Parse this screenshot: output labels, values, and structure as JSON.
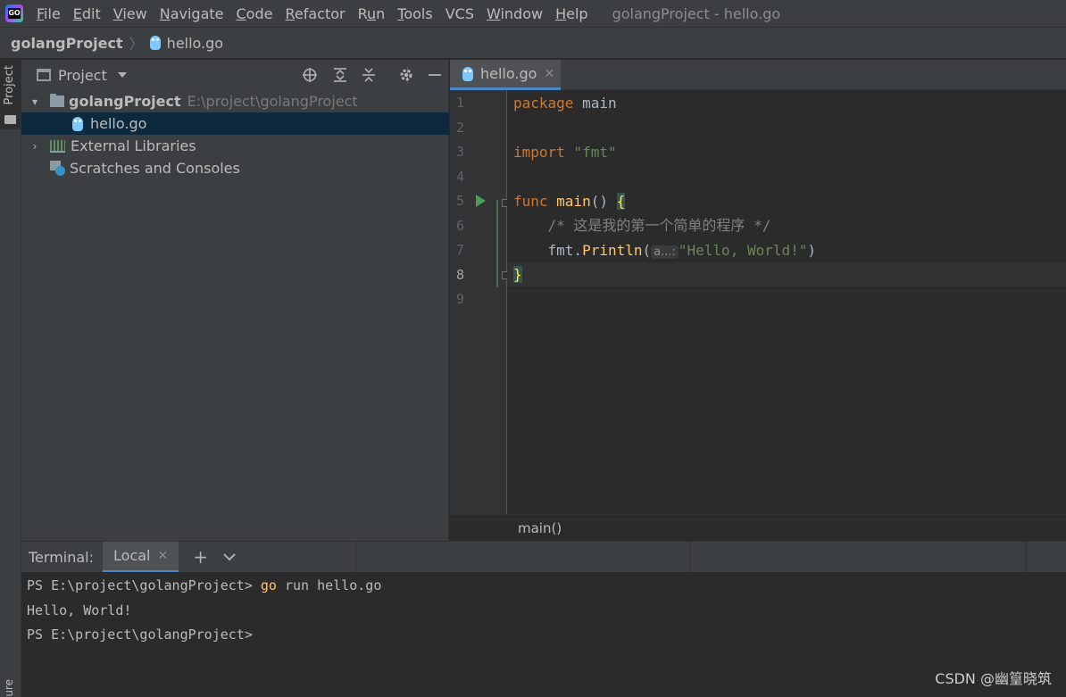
{
  "menubar": {
    "items": [
      {
        "label": "File",
        "mnemonic": "F",
        "rest": "ile"
      },
      {
        "label": "Edit",
        "mnemonic": "E",
        "rest": "dit"
      },
      {
        "label": "View",
        "mnemonic": "V",
        "rest": "iew"
      },
      {
        "label": "Navigate",
        "mnemonic": "N",
        "rest": "avigate"
      },
      {
        "label": "Code",
        "mnemonic": "C",
        "rest": "ode"
      },
      {
        "label": "Refactor",
        "mnemonic": "R",
        "rest": "efactor"
      },
      {
        "label": "Run",
        "mnemonic": "R",
        "rest": "un",
        "prefix": "R",
        "under": "u",
        "suffix": "n"
      },
      {
        "label": "Tools",
        "mnemonic": "T",
        "rest": "ools"
      },
      {
        "label": "VCS",
        "mnemonic": "",
        "rest": "VCS"
      },
      {
        "label": "Window",
        "mnemonic": "W",
        "rest": "indow"
      },
      {
        "label": "Help",
        "mnemonic": "H",
        "rest": "elp"
      }
    ],
    "window_title": "golangProject - hello.go"
  },
  "navbar": {
    "project": "golangProject",
    "file": "hello.go"
  },
  "left_strip": {
    "project_tab": "Project",
    "bottom_tab": "ure"
  },
  "project_panel": {
    "title": "Project",
    "tree": {
      "root_name": "golangProject",
      "root_path": "E:\\project\\golangProject",
      "file": "hello.go",
      "libs": "External Libraries",
      "scratches": "Scratches and Consoles"
    }
  },
  "editor": {
    "tab_label": "hello.go",
    "line_numbers": [
      "1",
      "2",
      "3",
      "4",
      "5",
      "6",
      "7",
      "8",
      "9"
    ],
    "code": {
      "l1_kw": "package",
      "l1_name": " main",
      "l3_kw": "import",
      "l3_str": " \"fmt\"",
      "l5_kw": "func",
      "l5_fn": " main",
      "l5_paren": "() ",
      "l5_brace": "{",
      "l6_comment": "    /* 这是我的第一个简单的程序 */",
      "l7_pkg": "    fmt.",
      "l7_fn": "Println",
      "l7_open": "(",
      "l7_hint": "a...:",
      "l7_str": "\"Hello, World!\"",
      "l7_close": ")",
      "l8_brace": "}"
    },
    "breadcrumb": "main()"
  },
  "terminal": {
    "label": "Terminal:",
    "tab": "Local",
    "lines": {
      "l1_prompt": "PS E:\\project\\golangProject> ",
      "l1_cmd": "go",
      "l1_args": " run hello.go",
      "l2": "Hello, World!",
      "l3": "PS E:\\project\\golangProject>"
    }
  },
  "watermark": "CSDN @幽篁晓筑"
}
